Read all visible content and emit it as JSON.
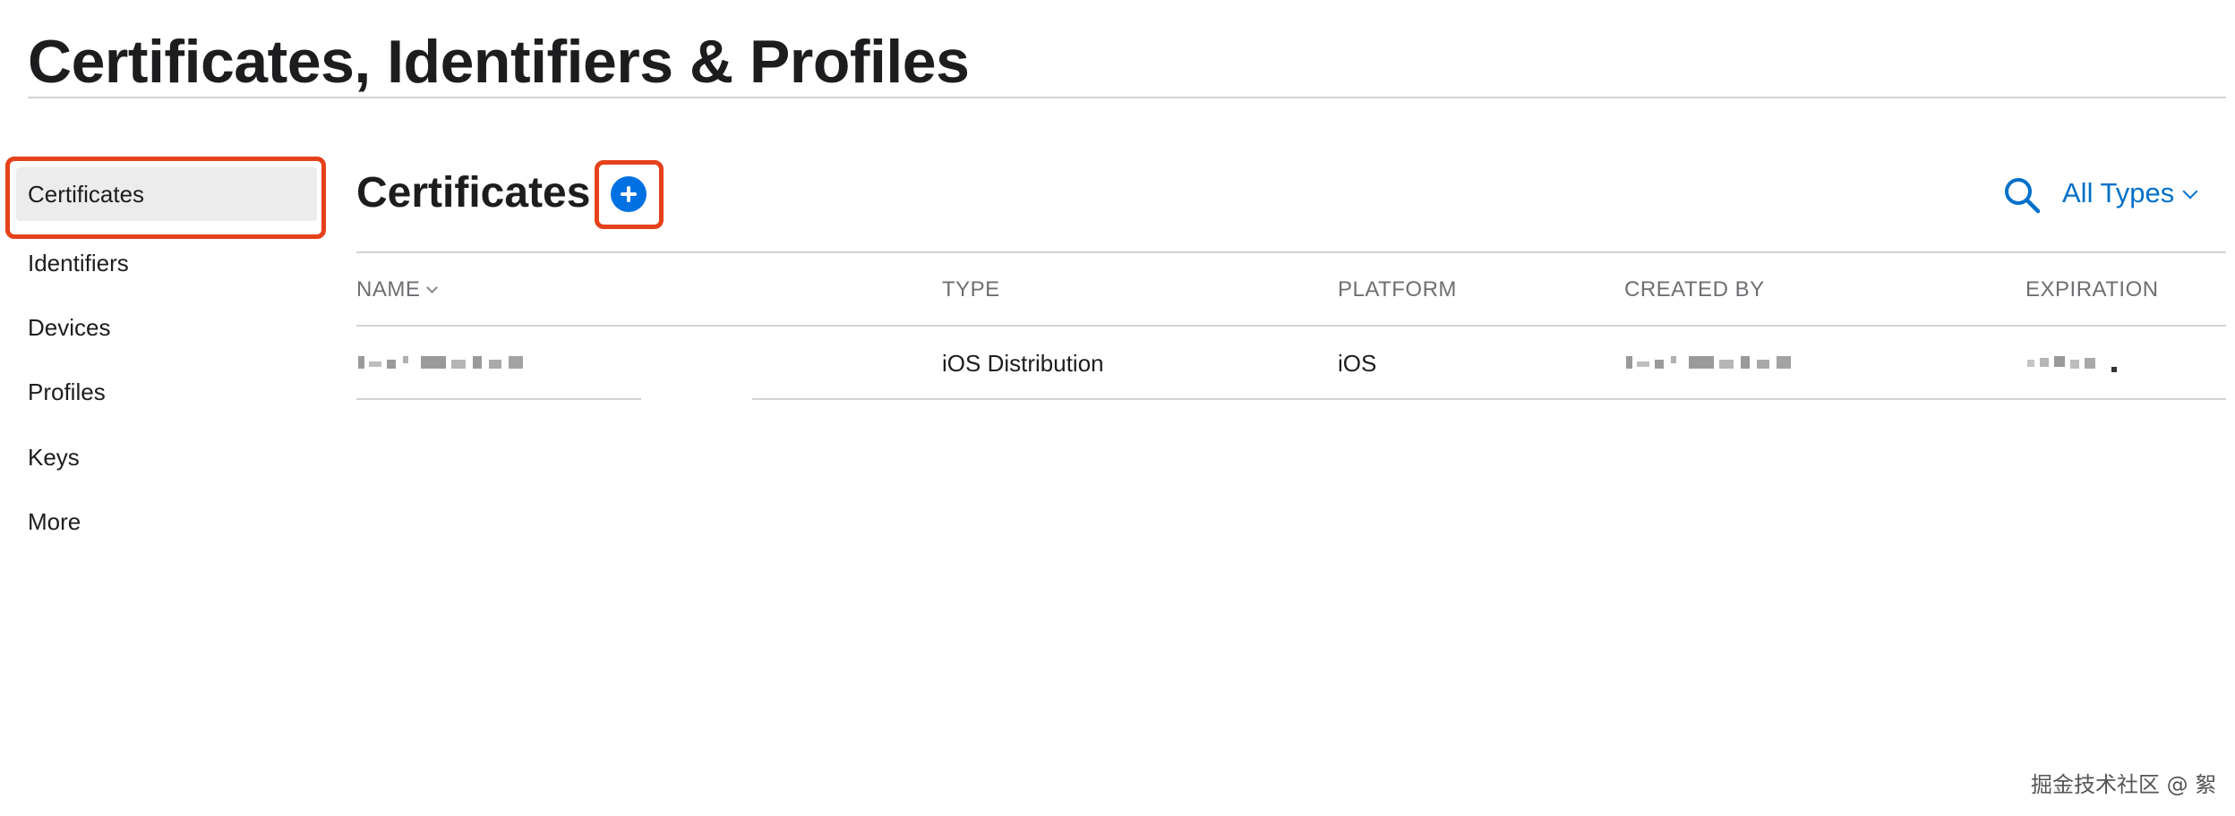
{
  "page": {
    "title": "Certificates, Identifiers & Profiles"
  },
  "sidebar": {
    "items": [
      {
        "label": "Certificates",
        "selected": true
      },
      {
        "label": "Identifiers",
        "selected": false
      },
      {
        "label": "Devices",
        "selected": false
      },
      {
        "label": "Profiles",
        "selected": false
      },
      {
        "label": "Keys",
        "selected": false
      },
      {
        "label": "More",
        "selected": false
      }
    ]
  },
  "main": {
    "section_title": "Certificates",
    "add_icon": "plus-circle-icon",
    "search_icon": "search-icon",
    "filter": {
      "selected": "All Types"
    }
  },
  "table": {
    "columns": [
      {
        "label": "NAME",
        "sortable": true
      },
      {
        "label": "TYPE"
      },
      {
        "label": "PLATFORM"
      },
      {
        "label": "CREATED BY"
      },
      {
        "label": "EXPIRATION"
      }
    ],
    "rows": [
      {
        "name": "",
        "type": "iOS Distribution",
        "platform": "iOS",
        "created_by": "",
        "expiration": ""
      }
    ]
  },
  "watermark": "掘金技术社区 @ 絮",
  "colors": {
    "accent": "#0071e3",
    "link": "#0070c9",
    "highlight": "#e5411a",
    "selected_bg": "#ececec"
  }
}
